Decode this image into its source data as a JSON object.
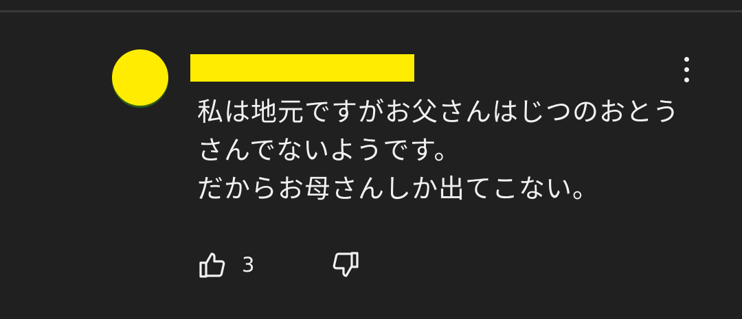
{
  "comment": {
    "lines": [
      "私は地元ですがお父さんはじつのおとう",
      "さんでないようです。",
      "だからお母さんしか出てこない。"
    ],
    "like_count": "3"
  },
  "icons": {
    "more": "more-vertical-icon",
    "like": "thumbs-up-icon",
    "dislike": "thumbs-down-icon"
  },
  "colors": {
    "background": "#202020",
    "text": "#f1f1f1",
    "redaction_yellow": "#ffec00",
    "divider": "#3a3a3a"
  }
}
